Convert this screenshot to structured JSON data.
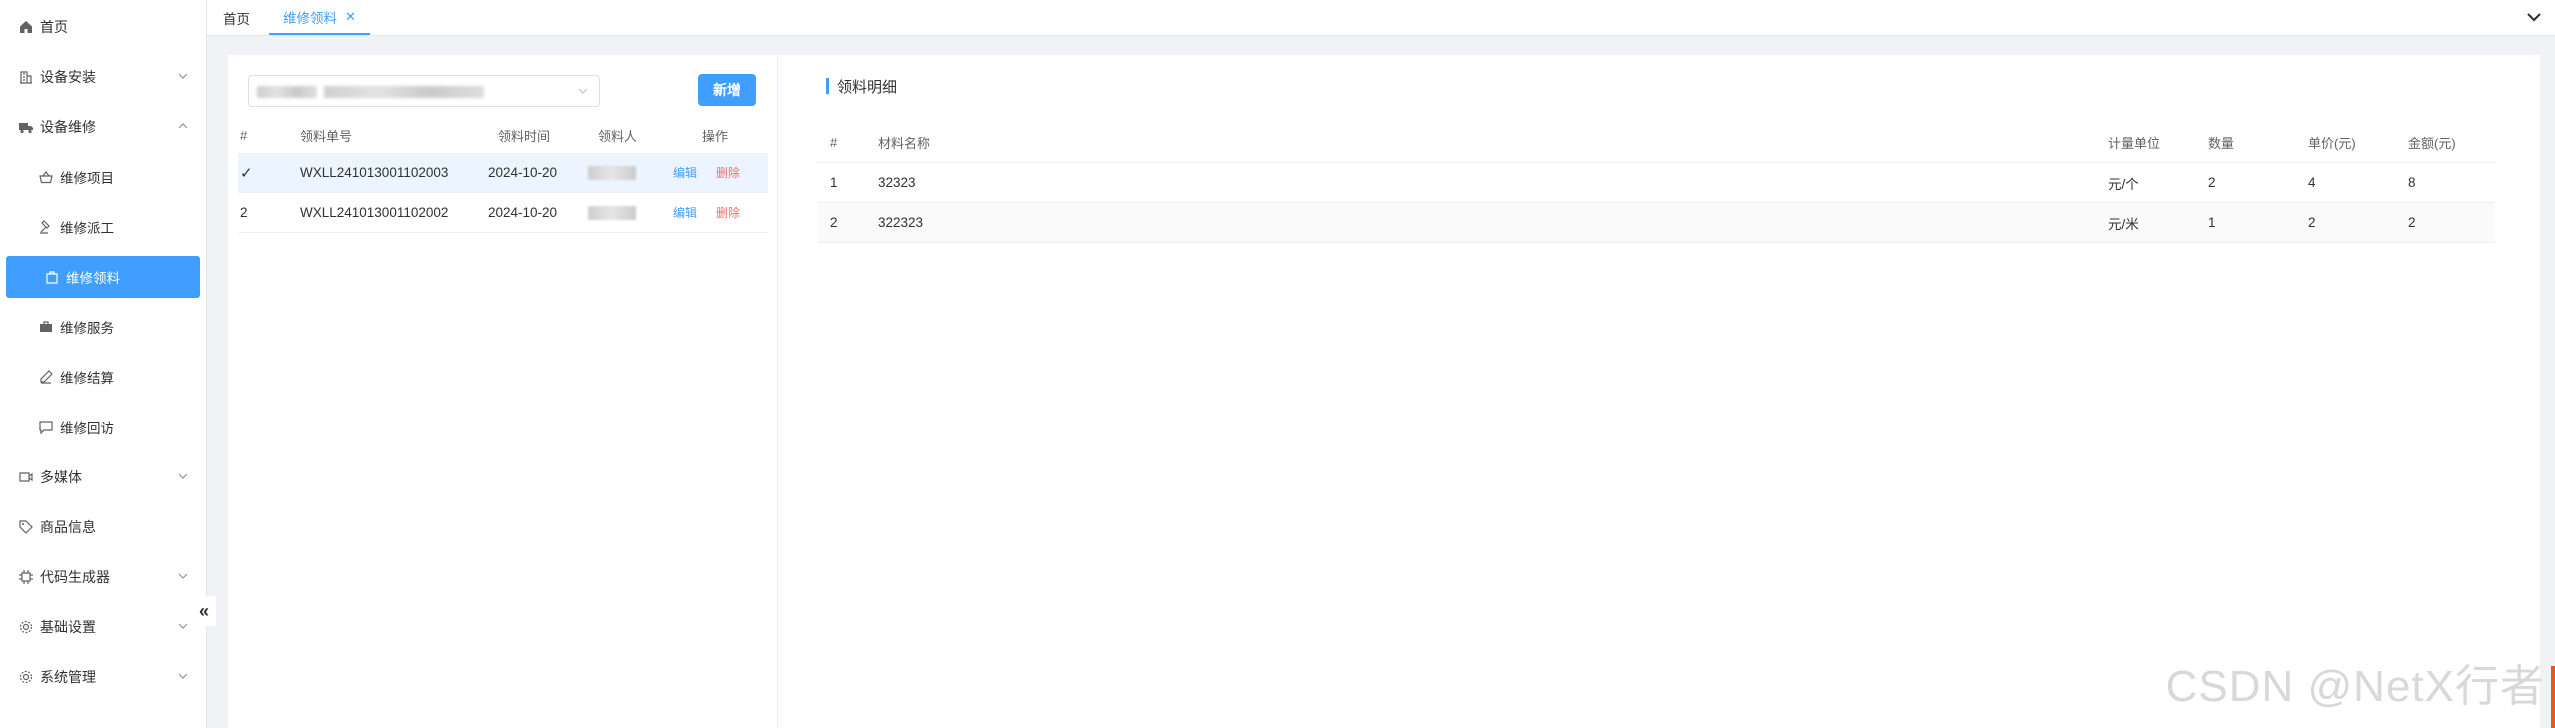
{
  "sidebar": {
    "items": [
      {
        "label": "首页",
        "icon": "home-icon"
      },
      {
        "label": "设备安装",
        "icon": "building-icon"
      },
      {
        "label": "设备维修",
        "icon": "truck-icon"
      },
      {
        "label": "维修项目",
        "icon": "basket-icon"
      },
      {
        "label": "维修派工",
        "icon": "hammer-icon"
      },
      {
        "label": "维修领料",
        "icon": "bag-icon"
      },
      {
        "label": "维修服务",
        "icon": "briefcase-icon"
      },
      {
        "label": "维修结算",
        "icon": "pen-icon"
      },
      {
        "label": "维修回访",
        "icon": "chat-icon"
      },
      {
        "label": "多媒体",
        "icon": "video-icon"
      },
      {
        "label": "商品信息",
        "icon": "tag-icon"
      },
      {
        "label": "代码生成器",
        "icon": "cpu-icon"
      },
      {
        "label": "基础设置",
        "icon": "gear-icon"
      },
      {
        "label": "系统管理",
        "icon": "gear-icon"
      }
    ]
  },
  "tabs": [
    {
      "label": "首页"
    },
    {
      "label": "维修领料"
    }
  ],
  "left": {
    "add_label": "新增",
    "headers": [
      "#",
      "领料单号",
      "领料时间",
      "领料人",
      "操作"
    ],
    "rows": [
      {
        "no": "✓",
        "code": "WXLL241013001102003",
        "time": "2024-10-20",
        "edit": "编辑",
        "del": "删除"
      },
      {
        "no": "2",
        "code": "WXLL241013001102002",
        "time": "2024-10-20",
        "edit": "编辑",
        "del": "删除"
      }
    ]
  },
  "right": {
    "title": "领料明细",
    "headers": [
      "#",
      "材料名称",
      "计量单位",
      "数量",
      "单价(元)",
      "金额(元)"
    ],
    "rows": [
      {
        "no": "1",
        "name": "32323",
        "unit": "元/个",
        "qty": "2",
        "price": "4",
        "amount": "8"
      },
      {
        "no": "2",
        "name": "322323",
        "unit": "元/米",
        "qty": "1",
        "price": "2",
        "amount": "2"
      }
    ]
  },
  "watermark": "CSDN @NetX行者",
  "colors": {
    "accent": "#409eff",
    "danger": "#f56c6c"
  }
}
